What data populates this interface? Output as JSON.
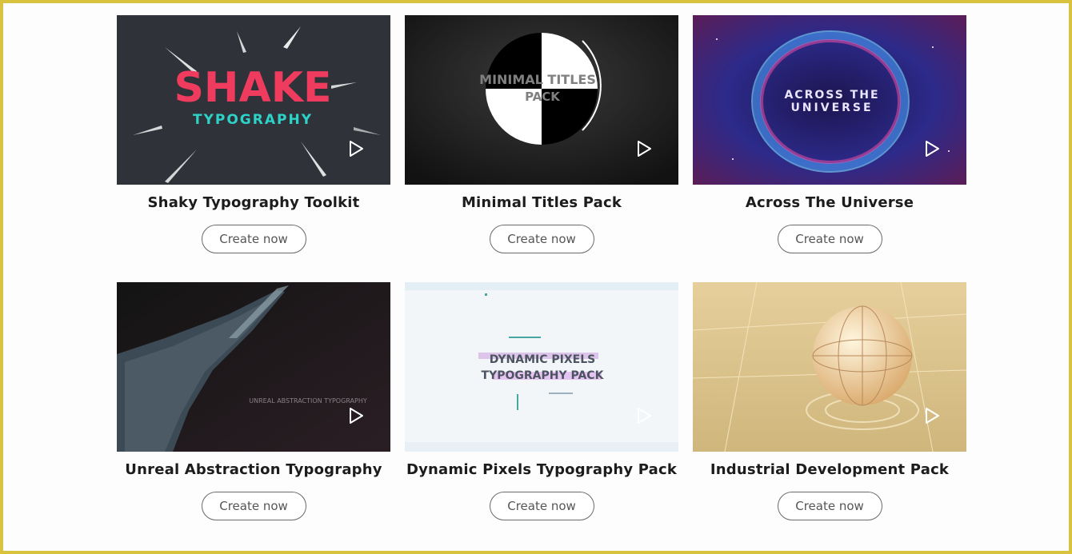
{
  "colors": {
    "frame_border": "#d9c23e",
    "button_border": "#6a6a6a",
    "title_text": "#1c1c1c"
  },
  "icons": {
    "play": "play-icon"
  },
  "cards": [
    {
      "title": "Shaky Typography Toolkit",
      "button_label": "Create now",
      "thumb_text_1": "SHAKE",
      "thumb_text_2": "TYPOGRAPHY"
    },
    {
      "title": "Minimal Titles Pack",
      "button_label": "Create now",
      "thumb_text_1": "MINIMAL TITLES",
      "thumb_text_2": "PACK"
    },
    {
      "title": "Across The Universe",
      "button_label": "Create now",
      "thumb_text_1": "ACROSS THE",
      "thumb_text_2": "UNIVERSE"
    },
    {
      "title": "Unreal Abstraction Typography",
      "button_label": "Create now",
      "thumb_text_1": "UNREAL ABSTRACTION TYPOGRAPHY"
    },
    {
      "title": "Dynamic Pixels Typography Pack",
      "button_label": "Create now",
      "thumb_text_1": "DYNAMIC PIXELS",
      "thumb_text_2": "TYPOGRAPHY PACK"
    },
    {
      "title": "Industrial Development Pack",
      "button_label": "Create now"
    }
  ]
}
